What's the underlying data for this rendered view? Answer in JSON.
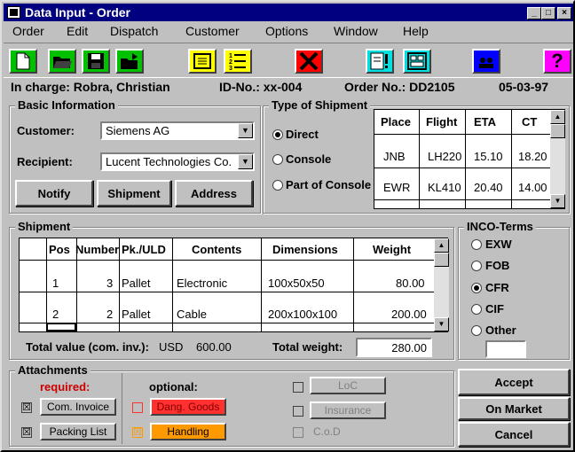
{
  "window": {
    "title": "Data Input - Order"
  },
  "menu": [
    "Order",
    "Edit",
    "Dispatch",
    "Customer",
    "Options",
    "Window",
    "Help"
  ],
  "toolbar": {
    "icons": [
      "new-document-icon",
      "open-folder-icon",
      "save-disk-icon",
      "export-folder-icon",
      "notes-icon",
      "list-icon",
      "delete-x-icon",
      "alert-document-icon",
      "form-icon",
      "users-icon",
      "help-question-icon"
    ],
    "help_glyph": "?"
  },
  "info": {
    "in_charge": "In charge: Robra, Christian",
    "id_no": "ID-No.: xx-004",
    "order_no": "Order No.: DD2105",
    "date": "05-03-97"
  },
  "basic": {
    "title": "Basic Information",
    "customer_label": "Customer:",
    "customer_value": "Siemens AG",
    "recipient_label": "Recipient:",
    "recipient_value": "Lucent Technologies Co.",
    "buttons": {
      "notify": "Notify",
      "shipment": "Shipment",
      "address": "Address"
    }
  },
  "type_of_shipment": {
    "title": "Type of Shipment",
    "options": {
      "direct": "Direct",
      "console": "Console",
      "part": "Part of Console"
    },
    "selected": "Direct",
    "columns": {
      "place": "Place",
      "flight": "Flight",
      "eta": "ETA",
      "ct": "CT"
    },
    "rows": [
      {
        "place": "JNB",
        "flight": "LH220",
        "eta": "15.10",
        "ct": "18.20"
      },
      {
        "place": "EWR",
        "flight": "KL410",
        "eta": "20.40",
        "ct": "14.00"
      }
    ]
  },
  "shipment": {
    "title": "Shipment",
    "columns": {
      "pos": "Pos",
      "number": "Number",
      "pk": "Pk./ULD",
      "contents": "Contents",
      "dimensions": "Dimensions",
      "weight": "Weight"
    },
    "rows": [
      {
        "pos": "1",
        "number": "3",
        "pk": "Pallet",
        "contents": "Electronic",
        "dimensions": "100x50x50",
        "weight": "80.00"
      },
      {
        "pos": "2",
        "number": "2",
        "pk": "Pallet",
        "contents": "Cable",
        "dimensions": "200x100x100",
        "weight": "200.00"
      }
    ],
    "total_value_label": "Total value (com. inv.):",
    "currency": "USD",
    "total_value": "600.00",
    "total_weight_label": "Total weight:",
    "total_weight": "280.00"
  },
  "inco": {
    "title": "INCO-Terms",
    "options": {
      "exw": "EXW",
      "fob": "FOB",
      "cfr": "CFR",
      "cif": "CIF",
      "other": "Other"
    },
    "selected": "CFR",
    "other_value": ""
  },
  "attachments": {
    "title": "Attachments",
    "required_label": "required:",
    "optional_label": "optional:",
    "com_invoice": "Com. Invoice",
    "packing_list": "Packing List",
    "dang_goods": "Dang. Goods",
    "handling": "Handling",
    "loc": "LoC",
    "insurance": "Insurance",
    "cod": "C.o.D",
    "check_glyph": "☒"
  },
  "actions": {
    "accept": "Accept",
    "on_market": "On Market",
    "cancel": "Cancel"
  },
  "colors": {
    "title_bar": "#000080",
    "required": "#cc0000",
    "dang_goods": "#ff3030",
    "handling": "#ff9900",
    "toolbar_green": "#00c000",
    "toolbar_yellow": "#ffff00",
    "toolbar_red": "#ff0000",
    "toolbar_cyan": "#00e0e0",
    "toolbar_blue": "#0000ff",
    "toolbar_magenta": "#ff00ff"
  }
}
